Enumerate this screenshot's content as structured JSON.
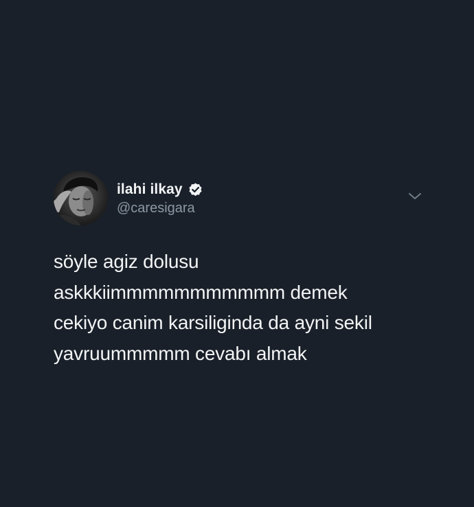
{
  "tweet": {
    "author": {
      "display_name": "ilahi ilkay",
      "handle": "@caresigara",
      "verified": true
    },
    "icons": {
      "verified": "verified-badge-icon",
      "menu": "chevron-down-icon"
    },
    "text_lines": [
      "söyle agiz dolusu",
      "askkkiimmmmmmmmmmm demek",
      "cekiyo canim karsiliginda da ayni sekil",
      "yavruummmmm cevabı almak"
    ]
  },
  "colors": {
    "background": "#1a2029",
    "text_primary": "#f2f4f5",
    "text_secondary": "#8b98a5"
  }
}
